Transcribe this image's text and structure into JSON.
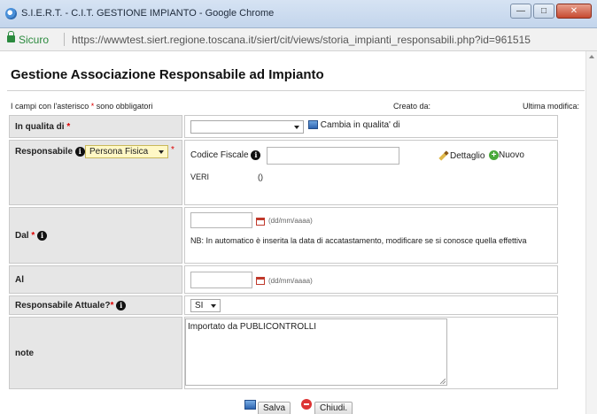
{
  "window": {
    "title": "S.I.E.R.T. - C.I.T. GESTIONE IMPIANTO - Google Chrome",
    "controls": {
      "minimize": "—",
      "maximize": "□",
      "close": "✕"
    }
  },
  "address_bar": {
    "secure_label": "Sicuro",
    "url": "https://wwwtest.siert.regione.toscana.it/siert/cit/views/storia_impianti_responsabili.php?id=961515"
  },
  "page": {
    "title": "Gestione Associazione Responsabile ad Impianto",
    "required_note_prefix": "I campi con l'asterisco ",
    "required_note_star": "*",
    "required_note_suffix": " sono obbligatori",
    "created_label": "Creato da:",
    "modified_label": "Ultima modifica:"
  },
  "form": {
    "in_qualita": {
      "label": "In qualita di",
      "star": "*",
      "select_value": "",
      "change_link": "Cambia in qualita' di"
    },
    "responsabile": {
      "label": "Responsabile",
      "type_select": "Persona Fisica",
      "star": "*",
      "cf_label": "Codice Fiscale",
      "cf_value": "",
      "verify_text": "VERI",
      "paren_text": "()",
      "detail_link": "Dettaglio",
      "new_link": "Nuovo"
    },
    "dal": {
      "label": "Dal",
      "star": "*",
      "value": "",
      "format_hint": "(dd/mm/aaaa)",
      "note": "NB: In automatico è inserita la data di accatastamento, modificare se si conosce quella effettiva"
    },
    "al": {
      "label": "Al",
      "value": "",
      "format_hint": "(dd/mm/aaaa)"
    },
    "attuale": {
      "label": "Responsabile Attuale?",
      "star": "*",
      "select_value": "SI"
    },
    "note": {
      "label": "note",
      "value": "Importato da PUBLICONTROLLI"
    }
  },
  "footer": {
    "save_label": "Salva",
    "close_label": "Chiudi."
  }
}
